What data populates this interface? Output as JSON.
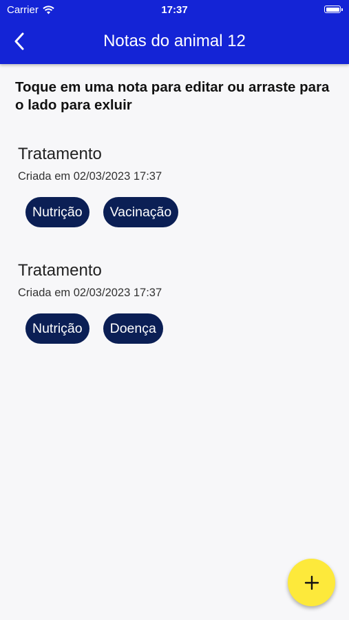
{
  "status_bar": {
    "carrier": "Carrier",
    "time": "17:37"
  },
  "header": {
    "title": "Notas do animal 12",
    "back_icon": "chevron-left-icon"
  },
  "instructions": "Toque em uma nota para editar ou arraste para o lado para exluir",
  "notes": [
    {
      "title": "Tratamento",
      "date": "Criada em 02/03/2023 17:37",
      "tags": [
        "Nutrição",
        "Vacinação"
      ]
    },
    {
      "title": "Tratamento",
      "date": "Criada em 02/03/2023 17:37",
      "tags": [
        "Nutrição",
        "Doença"
      ]
    }
  ],
  "fab": {
    "icon": "plus-icon"
  },
  "colors": {
    "header": "#1424d6",
    "tag": "#0b1f55",
    "fab": "#fde93b"
  }
}
